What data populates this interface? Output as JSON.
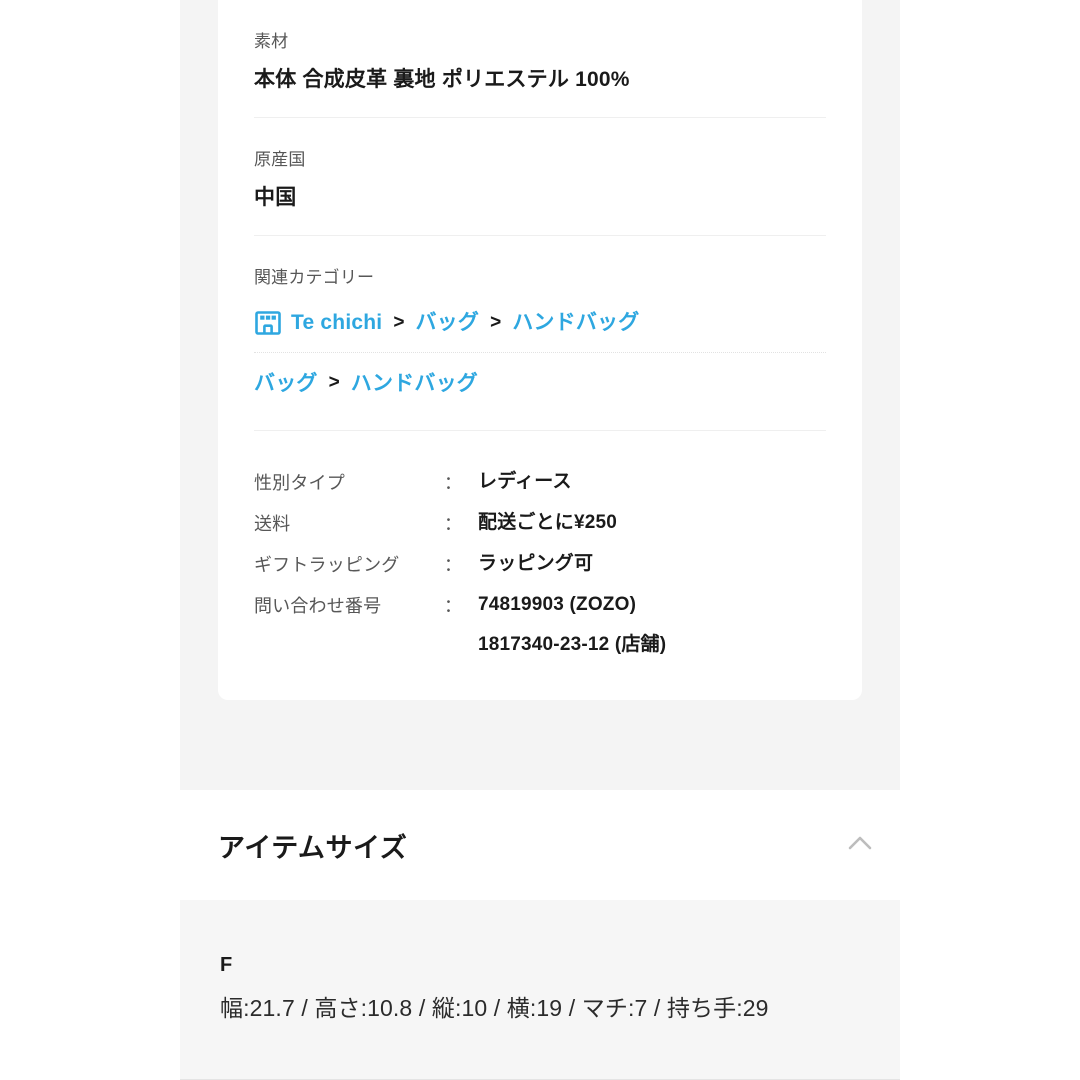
{
  "colors": {
    "link_blue": "#2ea7e0",
    "text_dark": "#1a1a1a",
    "text_muted": "#575757",
    "panel_gray": "#f6f6f6",
    "band_gray": "#f4f4f4",
    "chevron_gray": "#bdbdbd"
  },
  "product_info": {
    "attributes": [
      {
        "label": "素材",
        "value": "本体  合成皮革  裏地  ポリエステル 100%"
      },
      {
        "label": "原産国",
        "value": "中国"
      }
    ],
    "related_category": {
      "label": "関連カテゴリー",
      "rows": [
        {
          "has_shop_icon": true,
          "icon_name": "shop-icon",
          "crumbs": [
            "Te chichi",
            "バッグ",
            "ハンドバッグ"
          ],
          "separator": ">"
        },
        {
          "has_shop_icon": false,
          "crumbs": [
            "バッグ",
            "ハンドバッグ"
          ],
          "separator": ">"
        }
      ]
    },
    "specs": {
      "colon": "：",
      "rows": [
        {
          "key": "性別タイプ",
          "value": "レディース",
          "value2": ""
        },
        {
          "key": "送料",
          "value": "配送ごとに¥250",
          "value2": ""
        },
        {
          "key": "ギフトラッピング",
          "value": "ラッピング可",
          "value2": ""
        },
        {
          "key": "問い合わせ番号",
          "value": "74819903 (ZOZO)",
          "value2": "1817340-23-12 (店舗)"
        }
      ]
    }
  },
  "item_size": {
    "title": "アイテムサイズ",
    "toggle_icon": "chevron-up-icon",
    "entries": [
      {
        "size_name": "F",
        "dimensions": "幅:21.7 / 高さ:10.8 / 縦:10 / 横:19 / マチ:7 / 持ち手:29"
      }
    ]
  }
}
